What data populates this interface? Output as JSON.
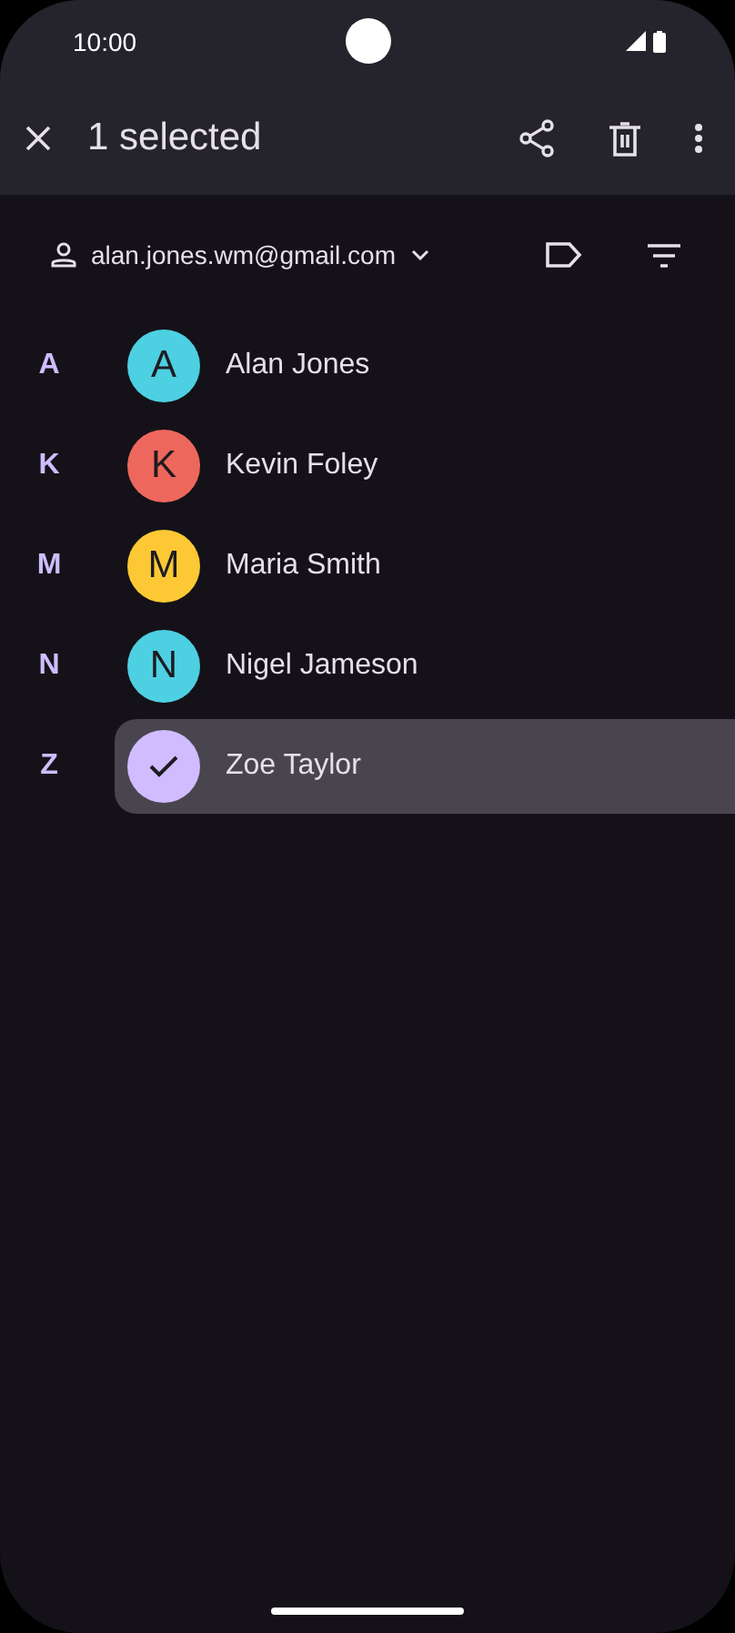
{
  "status_bar": {
    "time": "10:00"
  },
  "app_bar": {
    "title": "1 selected"
  },
  "account": {
    "email": "alan.jones.wm@gmail.com"
  },
  "contacts": [
    {
      "section": "A",
      "initial": "A",
      "name": "Alan Jones",
      "color": "#4dd0e1",
      "selected": false
    },
    {
      "section": "K",
      "initial": "K",
      "name": "Kevin Foley",
      "color": "#ee675c",
      "selected": false
    },
    {
      "section": "M",
      "initial": "M",
      "name": "Maria Smith",
      "color": "#fcc934",
      "selected": false
    },
    {
      "section": "N",
      "initial": "N",
      "name": "Nigel Jameson",
      "color": "#4dd0e1",
      "selected": false
    },
    {
      "section": "Z",
      "name": "Zoe Taylor",
      "color": "#d0bcff",
      "selected": true
    }
  ]
}
